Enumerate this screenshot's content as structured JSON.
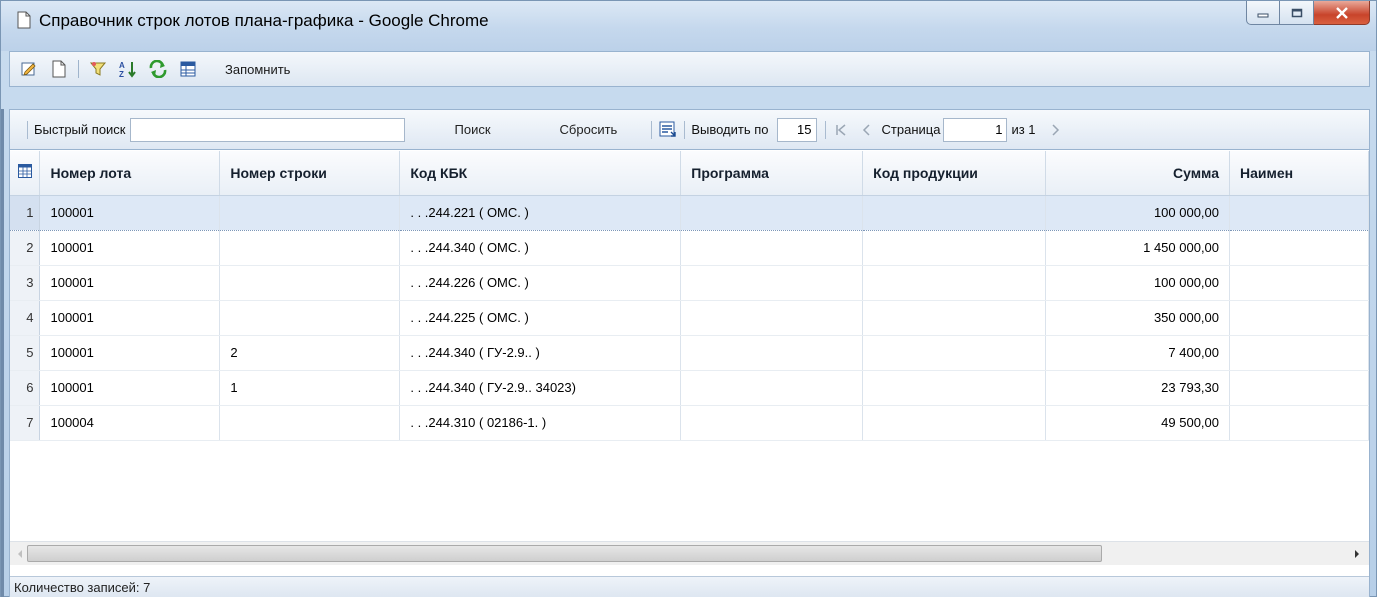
{
  "window": {
    "title": "Справочник строк лотов плана-графика - Google Chrome",
    "accent_color": "#c5d8ed",
    "close_color": "#c8442b"
  },
  "toolbar": {
    "icons": [
      "edit-icon",
      "new-document-icon",
      "filter-icon",
      "sort-icon",
      "refresh-icon",
      "table-settings-icon"
    ],
    "remember_label": "Запомнить"
  },
  "search": {
    "label": "Быстрый поиск",
    "value": "",
    "search_button": "Поиск",
    "reset_button": "Сбросить",
    "page_size_label": "Выводить по",
    "page_size": "15",
    "page_label": "Страница",
    "page_value": "1",
    "page_total": "из 1"
  },
  "grid": {
    "columns": [
      "Номер лота",
      "Номер строки",
      "Код КБК",
      "Программа",
      "Код продукции",
      "Сумма",
      "Наимен"
    ],
    "rows": [
      {
        "n": "1",
        "lot": "100001",
        "line": "",
        "kbk": ". . .244.221 ( ОМС. )",
        "program": "",
        "product": "",
        "sum": "100 000,00"
      },
      {
        "n": "2",
        "lot": "100001",
        "line": "",
        "kbk": ". . .244.340 ( ОМС. )",
        "program": "",
        "product": "",
        "sum": "1 450 000,00"
      },
      {
        "n": "3",
        "lot": "100001",
        "line": "",
        "kbk": ". . .244.226 ( ОМС. )",
        "program": "",
        "product": "",
        "sum": "100 000,00"
      },
      {
        "n": "4",
        "lot": "100001",
        "line": "",
        "kbk": ". . .244.225 ( ОМС. )",
        "program": "",
        "product": "",
        "sum": "350 000,00"
      },
      {
        "n": "5",
        "lot": "100001",
        "line": "2",
        "kbk": ". . .244.340 ( ГУ-2.9.. )",
        "program": "",
        "product": "",
        "sum": "7 400,00"
      },
      {
        "n": "6",
        "lot": "100001",
        "line": "1",
        "kbk": ". . .244.340 ( ГУ-2.9.. 34023)",
        "program": "",
        "product": "",
        "sum": "23 793,30"
      },
      {
        "n": "7",
        "lot": "100004",
        "line": "",
        "kbk": ". . .244.310 ( 02186-1. )",
        "program": "",
        "product": "",
        "sum": "49 500,00"
      }
    ],
    "selected_row": 0
  },
  "status": {
    "records": "Количество записей: 7"
  }
}
